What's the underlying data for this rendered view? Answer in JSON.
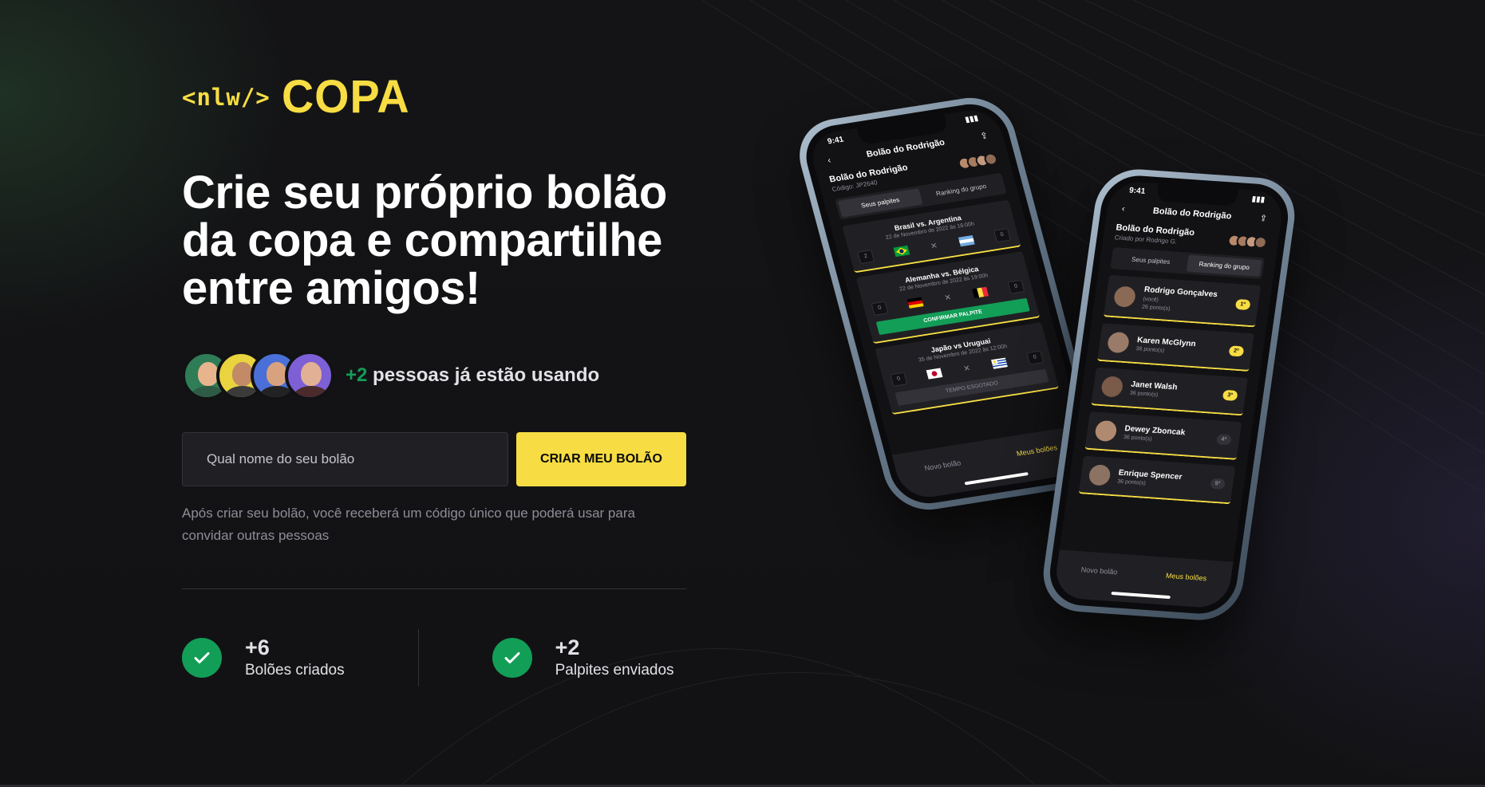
{
  "logo": {
    "nlw": "<nlw/>",
    "copa": "COPA"
  },
  "headline": {
    "line1": "Crie seu próprio bolão",
    "line2": "da copa e compartilhe",
    "line3": "entre amigos!"
  },
  "users": {
    "count": "+2",
    "text": " pessoas já estão usando"
  },
  "form": {
    "placeholder": "Qual nome do seu bolão",
    "button": "CRIAR MEU BOLÃO",
    "help": "Após criar seu bolão, você receberá um código único que poderá usar para convidar outras pessoas"
  },
  "stats": [
    {
      "value": "+6",
      "label": "Bolões criados"
    },
    {
      "value": "+2",
      "label": "Palpites enviados"
    }
  ],
  "colors": {
    "accent": "#F7DD43",
    "success": "#129E57",
    "background": "#121214",
    "input": "#202024"
  },
  "phone_back": {
    "time": "9:41",
    "title": "Bolão do Rodrigão",
    "pool_name": "Bolão do Rodrigão",
    "pool_code": "Código: JP2640",
    "tabs": [
      "Seus palpites",
      "Ranking do grupo"
    ],
    "games": [
      {
        "teams": "Brasil vs. Argentina",
        "date": "22 de Novembro de 2022 às 16:00h"
      },
      {
        "teams": "Alemanha vs. Bélgica",
        "date": "22 de Novembro de 2022 às 19:00h",
        "action": "CONFIRMAR PALPITE"
      },
      {
        "teams": "Japão vs Uruguai",
        "date": "35 de Novembro de 2022 às 12:00h",
        "action": "TEMPO ESGOTADO"
      }
    ],
    "nav": [
      "Novo bolão",
      "Meus bolões"
    ]
  },
  "phone_front": {
    "time": "9:41",
    "title": "Bolão do Rodrigão",
    "pool_name": "Bolão do Rodrigão",
    "pool_creator": "Criado por Rodrigo G.",
    "tabs": [
      "Seus palpites",
      "Ranking do grupo"
    ],
    "ranking": [
      {
        "name": "Rodrigo Gonçalves",
        "tag": "(você)",
        "points": "26 ponto(s)",
        "pos": "1º"
      },
      {
        "name": "Karen McGlynn",
        "tag": "",
        "points": "36 ponto(s)",
        "pos": "2º"
      },
      {
        "name": "Janet Walsh",
        "tag": "",
        "points": "36 ponto(s)",
        "pos": "3º"
      },
      {
        "name": "Dewey Zboncak",
        "tag": "",
        "points": "36 ponto(s)",
        "pos": "4º"
      },
      {
        "name": "Enrique Spencer",
        "tag": "",
        "points": "36 ponto(s)",
        "pos": "5º"
      }
    ],
    "nav": [
      "Novo bolão",
      "Meus bolões"
    ]
  }
}
